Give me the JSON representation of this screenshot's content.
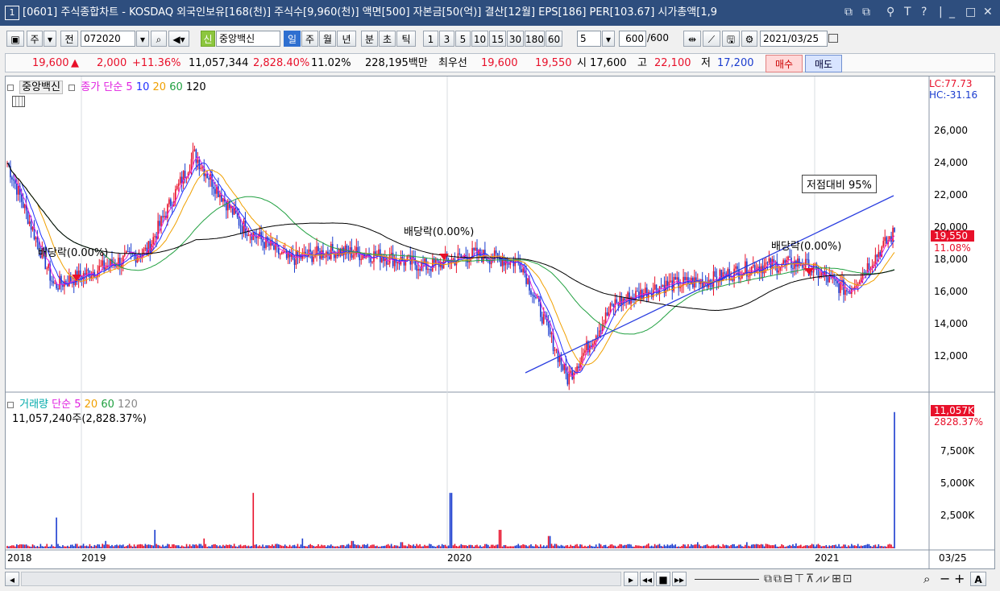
{
  "window": {
    "number": "1",
    "title": "[0601] 주식종합차트 - KOSDAQ 외국인보유[168(천)] 주식수[9,960(천)] 액면[500] 자본금[50(억)] 결산[12월] EPS[186] PER[103.67] 시가총액[1,9",
    "controls": [
      "T",
      "?",
      "|",
      "_",
      "□",
      "✕"
    ]
  },
  "toolbar": {
    "market": "주",
    "jeon": "전",
    "code": "072020",
    "stock_badge": "신",
    "stock_name": "중앙백신",
    "period_tabs": [
      "일",
      "주",
      "월",
      "년",
      "분",
      "초",
      "틱"
    ],
    "active_tab": "일",
    "intervals": [
      "1",
      "3",
      "5",
      "10",
      "15",
      "30",
      "180",
      "60"
    ],
    "interval_value": "5",
    "count": "600",
    "count_total": "/600",
    "date": "2021/03/25"
  },
  "quote": {
    "price": "19,600",
    "arrow": "▲",
    "change": "2,000",
    "change_pct": "+11.36%",
    "volume": "11,057,344",
    "volume_pct": "2,828.40%",
    "turnover": "11.02%",
    "trade_value": "228,195백만",
    "best_label": "최우선",
    "best_ask": "19,600",
    "best_bid": "19,550",
    "open_label": "시",
    "open": "17,600",
    "high_label": "고",
    "high": "22,100",
    "low_label": "저",
    "low": "17,200",
    "buy_button": "매수",
    "sell_button": "매도"
  },
  "price_panel": {
    "stock_label": "중앙백신",
    "ma_label": "종가 단순",
    "ma_periods": [
      "5",
      "10",
      "20",
      "60",
      "120"
    ],
    "lc": "LC:77.73",
    "hc": "HC:-31.16",
    "y_ticks": [
      "26,000",
      "24,000",
      "22,000",
      "20,000",
      "18,000",
      "16,000",
      "14,000",
      "12,000"
    ],
    "current_price_tag": "19,550",
    "current_pct_tag": "11.08%",
    "annotation_box": "저점대비 95%",
    "dividend_labels": [
      "배당락(0.00%)",
      "배당락(0.00%)",
      "배당락(0.00%)"
    ]
  },
  "volume_panel": {
    "label": "거래량",
    "ma_label": "단순",
    "ma_periods": [
      "5",
      "20",
      "60",
      "120"
    ],
    "value_line": "11,057,240주(2,828.37%)",
    "tag_value": "11,057K",
    "tag_pct": "2828.37%",
    "y_ticks": [
      "7,500K",
      "5,000K",
      "2,500K"
    ]
  },
  "x_axis": {
    "labels": [
      "2018",
      "2019",
      "2020",
      "2021"
    ],
    "end_label": "03/25"
  },
  "colors": {
    "up": "#e8102a",
    "down": "#1a3ccf",
    "ma5": "#e020e0",
    "ma10": "#2030ff",
    "ma20": "#f0a000",
    "ma60": "#20a040",
    "ma120": "#000000",
    "trendline": "#2a3ee0"
  },
  "chart_data": {
    "type": "line",
    "title": "",
    "ylabel": "",
    "ylim": [
      11000,
      27500
    ],
    "x": [
      "2018-11",
      "2019-01",
      "2019-02",
      "2019-04",
      "2019-05",
      "2019-06",
      "2019-08",
      "2019-10",
      "2019-12",
      "2020-01",
      "2020-02",
      "2020-03",
      "2020-04",
      "2020-05",
      "2020-06",
      "2020-08",
      "2020-10",
      "2020-12",
      "2021-01",
      "2021-03-25"
    ],
    "series": [
      {
        "name": "종가",
        "values": [
          23500,
          16500,
          17500,
          18500,
          24000,
          20000,
          18000,
          18500,
          18200,
          17600,
          18300,
          17800,
          11200,
          15500,
          16500,
          16800,
          17600,
          17800,
          16200,
          19550
        ]
      }
    ],
    "volume_series": {
      "name": "거래량",
      "values": [
        200,
        2500,
        600,
        1500,
        800,
        4500,
        800,
        600,
        500,
        4500,
        1500,
        1000,
        400,
        400,
        500,
        500,
        400,
        300,
        11057
      ]
    }
  }
}
